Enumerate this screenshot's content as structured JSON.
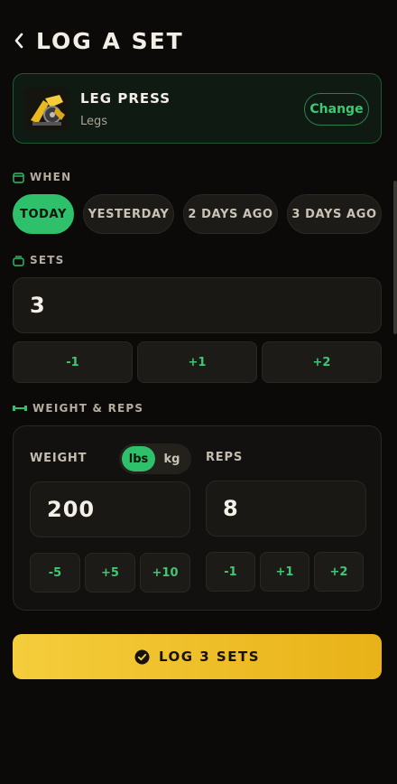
{
  "header": {
    "title": "LOG A SET"
  },
  "exercise": {
    "name": "LEG PRESS",
    "category": "Legs",
    "change_label": "Change"
  },
  "when": {
    "label": "WHEN",
    "options": [
      "TODAY",
      "YESTERDAY",
      "2 DAYS AGO",
      "3 DAYS AGO"
    ],
    "selected": "TODAY"
  },
  "sets": {
    "label": "SETS",
    "value": "3",
    "steps": [
      "-1",
      "+1",
      "+2"
    ]
  },
  "weight_reps": {
    "label": "WEIGHT & REPS",
    "weight_label": "WEIGHT",
    "units": [
      "lbs",
      "kg"
    ],
    "selected_unit": "lbs",
    "weight_value": "200",
    "weight_steps": [
      "-5",
      "+5",
      "+10"
    ],
    "reps_label": "REPS",
    "reps_value": "8",
    "reps_steps": [
      "-1",
      "+1",
      "+2"
    ]
  },
  "submit": {
    "label": "LOG 3 SETS"
  },
  "colors": {
    "accent_green": "#2ec06b",
    "accent_yellow": "#f5cd3c",
    "background": "#0b0a09"
  }
}
